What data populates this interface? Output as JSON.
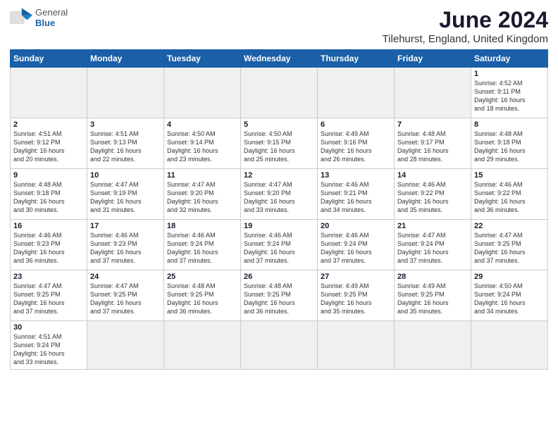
{
  "logo": {
    "text_general": "General",
    "text_blue": "Blue"
  },
  "title": "June 2024",
  "subtitle": "Tilehurst, England, United Kingdom",
  "headers": [
    "Sunday",
    "Monday",
    "Tuesday",
    "Wednesday",
    "Thursday",
    "Friday",
    "Saturday"
  ],
  "weeks": [
    [
      {
        "day": "",
        "info": "",
        "empty": true
      },
      {
        "day": "",
        "info": "",
        "empty": true
      },
      {
        "day": "",
        "info": "",
        "empty": true
      },
      {
        "day": "",
        "info": "",
        "empty": true
      },
      {
        "day": "",
        "info": "",
        "empty": true
      },
      {
        "day": "",
        "info": "",
        "empty": true
      },
      {
        "day": "1",
        "info": "Sunrise: 4:52 AM\nSunset: 9:11 PM\nDaylight: 16 hours\nand 18 minutes."
      }
    ],
    [
      {
        "day": "2",
        "info": "Sunrise: 4:51 AM\nSunset: 9:12 PM\nDaylight: 16 hours\nand 20 minutes."
      },
      {
        "day": "3",
        "info": "Sunrise: 4:51 AM\nSunset: 9:13 PM\nDaylight: 16 hours\nand 22 minutes."
      },
      {
        "day": "4",
        "info": "Sunrise: 4:50 AM\nSunset: 9:14 PM\nDaylight: 16 hours\nand 23 minutes."
      },
      {
        "day": "5",
        "info": "Sunrise: 4:50 AM\nSunset: 9:15 PM\nDaylight: 16 hours\nand 25 minutes."
      },
      {
        "day": "6",
        "info": "Sunrise: 4:49 AM\nSunset: 9:16 PM\nDaylight: 16 hours\nand 26 minutes."
      },
      {
        "day": "7",
        "info": "Sunrise: 4:48 AM\nSunset: 9:17 PM\nDaylight: 16 hours\nand 28 minutes."
      },
      {
        "day": "8",
        "info": "Sunrise: 4:48 AM\nSunset: 9:18 PM\nDaylight: 16 hours\nand 29 minutes."
      }
    ],
    [
      {
        "day": "9",
        "info": "Sunrise: 4:48 AM\nSunset: 9:18 PM\nDaylight: 16 hours\nand 30 minutes."
      },
      {
        "day": "10",
        "info": "Sunrise: 4:47 AM\nSunset: 9:19 PM\nDaylight: 16 hours\nand 31 minutes."
      },
      {
        "day": "11",
        "info": "Sunrise: 4:47 AM\nSunset: 9:20 PM\nDaylight: 16 hours\nand 32 minutes."
      },
      {
        "day": "12",
        "info": "Sunrise: 4:47 AM\nSunset: 9:20 PM\nDaylight: 16 hours\nand 33 minutes."
      },
      {
        "day": "13",
        "info": "Sunrise: 4:46 AM\nSunset: 9:21 PM\nDaylight: 16 hours\nand 34 minutes."
      },
      {
        "day": "14",
        "info": "Sunrise: 4:46 AM\nSunset: 9:22 PM\nDaylight: 16 hours\nand 35 minutes."
      },
      {
        "day": "15",
        "info": "Sunrise: 4:46 AM\nSunset: 9:22 PM\nDaylight: 16 hours\nand 36 minutes."
      }
    ],
    [
      {
        "day": "16",
        "info": "Sunrise: 4:46 AM\nSunset: 9:23 PM\nDaylight: 16 hours\nand 36 minutes."
      },
      {
        "day": "17",
        "info": "Sunrise: 4:46 AM\nSunset: 9:23 PM\nDaylight: 16 hours\nand 37 minutes."
      },
      {
        "day": "18",
        "info": "Sunrise: 4:46 AM\nSunset: 9:24 PM\nDaylight: 16 hours\nand 37 minutes."
      },
      {
        "day": "19",
        "info": "Sunrise: 4:46 AM\nSunset: 9:24 PM\nDaylight: 16 hours\nand 37 minutes."
      },
      {
        "day": "20",
        "info": "Sunrise: 4:46 AM\nSunset: 9:24 PM\nDaylight: 16 hours\nand 37 minutes."
      },
      {
        "day": "21",
        "info": "Sunrise: 4:47 AM\nSunset: 9:24 PM\nDaylight: 16 hours\nand 37 minutes."
      },
      {
        "day": "22",
        "info": "Sunrise: 4:47 AM\nSunset: 9:25 PM\nDaylight: 16 hours\nand 37 minutes."
      }
    ],
    [
      {
        "day": "23",
        "info": "Sunrise: 4:47 AM\nSunset: 9:25 PM\nDaylight: 16 hours\nand 37 minutes."
      },
      {
        "day": "24",
        "info": "Sunrise: 4:47 AM\nSunset: 9:25 PM\nDaylight: 16 hours\nand 37 minutes."
      },
      {
        "day": "25",
        "info": "Sunrise: 4:48 AM\nSunset: 9:25 PM\nDaylight: 16 hours\nand 36 minutes."
      },
      {
        "day": "26",
        "info": "Sunrise: 4:48 AM\nSunset: 9:25 PM\nDaylight: 16 hours\nand 36 minutes."
      },
      {
        "day": "27",
        "info": "Sunrise: 4:49 AM\nSunset: 9:25 PM\nDaylight: 16 hours\nand 35 minutes."
      },
      {
        "day": "28",
        "info": "Sunrise: 4:49 AM\nSunset: 9:25 PM\nDaylight: 16 hours\nand 35 minutes."
      },
      {
        "day": "29",
        "info": "Sunrise: 4:50 AM\nSunset: 9:24 PM\nDaylight: 16 hours\nand 34 minutes."
      }
    ],
    [
      {
        "day": "30",
        "info": "Sunrise: 4:51 AM\nSunset: 9:24 PM\nDaylight: 16 hours\nand 33 minutes.",
        "last": true
      },
      {
        "day": "",
        "info": "",
        "empty": true,
        "last": true
      },
      {
        "day": "",
        "info": "",
        "empty": true,
        "last": true
      },
      {
        "day": "",
        "info": "",
        "empty": true,
        "last": true
      },
      {
        "day": "",
        "info": "",
        "empty": true,
        "last": true
      },
      {
        "day": "",
        "info": "",
        "empty": true,
        "last": true
      },
      {
        "day": "",
        "info": "",
        "empty": true,
        "last": true
      }
    ]
  ]
}
